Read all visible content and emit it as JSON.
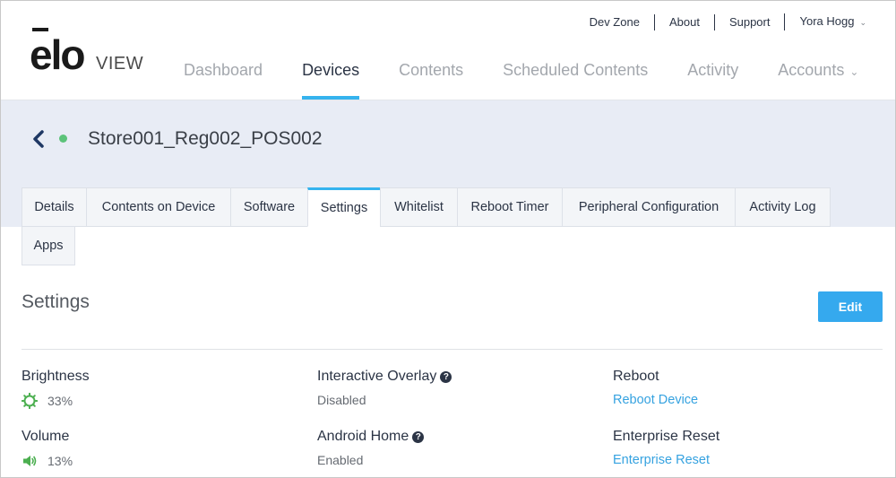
{
  "brand": {
    "logo_word": "ēlo",
    "logo_sub": "VIEW"
  },
  "util_nav": {
    "dev_zone": "Dev Zone",
    "about": "About",
    "support": "Support",
    "user": "Yora Hogg"
  },
  "main_nav": {
    "dashboard": "Dashboard",
    "devices": "Devices",
    "contents": "Contents",
    "scheduled": "Scheduled Contents",
    "activity": "Activity",
    "accounts": "Accounts"
  },
  "device": {
    "name": "Store001_Reg002_POS002",
    "status": "online"
  },
  "tabs": {
    "details": "Details",
    "contents_on_device": "Contents on Device",
    "software": "Software",
    "settings": "Settings",
    "whitelist": "Whitelist",
    "reboot_timer": "Reboot Timer",
    "peripheral_configuration": "Peripheral Configuration",
    "activity_log": "Activity Log",
    "apps": "Apps"
  },
  "settings": {
    "title": "Settings",
    "edit_label": "Edit",
    "brightness": {
      "label": "Brightness",
      "value": "33%"
    },
    "volume": {
      "label": "Volume",
      "value": "13%"
    },
    "interactive_overlay": {
      "label": "Interactive Overlay",
      "value": "Disabled"
    },
    "android_home": {
      "label": "Android Home",
      "value": "Enabled"
    },
    "reboot": {
      "label": "Reboot",
      "link": "Reboot Device"
    },
    "enterprise_reset": {
      "label": "Enterprise Reset",
      "link": "Enterprise Reset"
    }
  },
  "colors": {
    "accent": "#35b3ee",
    "button": "#35a9ee",
    "link": "#35a2e0",
    "status_online": "#5cc37a",
    "icon_green": "#4caf50",
    "band": "#e8ecf5",
    "text_dark": "#2b3445"
  }
}
